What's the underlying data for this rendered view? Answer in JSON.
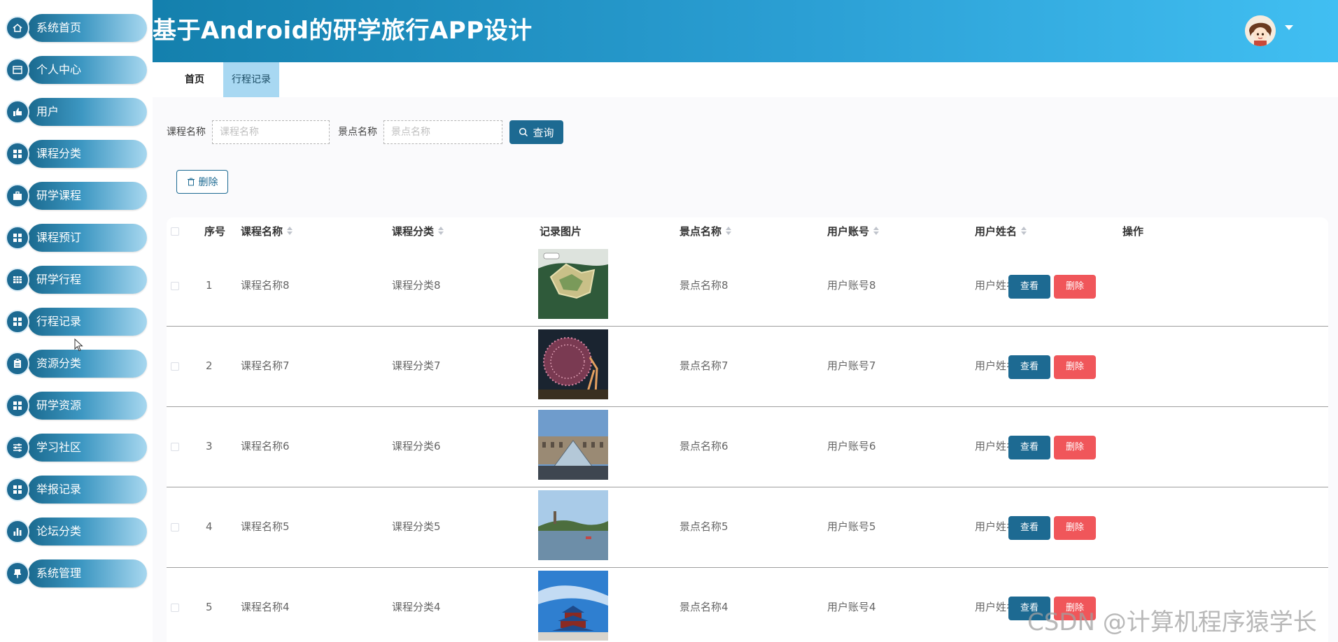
{
  "header": {
    "title": "基于Android的研学旅行APP设计"
  },
  "sidebar": {
    "items": [
      {
        "label": "系统首页",
        "icon": "home-icon"
      },
      {
        "label": "个人中心",
        "icon": "card-icon"
      },
      {
        "label": "用户",
        "icon": "thumb-icon"
      },
      {
        "label": "课程分类",
        "icon": "grid-icon"
      },
      {
        "label": "研学课程",
        "icon": "briefcase-icon"
      },
      {
        "label": "课程预订",
        "icon": "grid-icon"
      },
      {
        "label": "研学行程",
        "icon": "table-icon"
      },
      {
        "label": "行程记录",
        "icon": "grid-icon"
      },
      {
        "label": "资源分类",
        "icon": "clipboard-icon"
      },
      {
        "label": "研学资源",
        "icon": "grid-icon"
      },
      {
        "label": "学习社区",
        "icon": "sliders-icon"
      },
      {
        "label": "举报记录",
        "icon": "grid-icon"
      },
      {
        "label": "论坛分类",
        "icon": "bar-chart-icon"
      },
      {
        "label": "系统管理",
        "icon": "pushpin-icon"
      }
    ]
  },
  "tabs": [
    {
      "label": "首页",
      "active": false
    },
    {
      "label": "行程记录",
      "active": true
    }
  ],
  "search": {
    "course_label": "课程名称",
    "course_placeholder": "课程名称",
    "spot_label": "景点名称",
    "spot_placeholder": "景点名称",
    "query_label": "查询"
  },
  "toolbar": {
    "delete_label": "删除"
  },
  "table": {
    "columns": [
      "序号",
      "课程名称",
      "课程分类",
      "记录图片",
      "景点名称",
      "用户账号",
      "用户姓名",
      "操作"
    ],
    "rows": [
      {
        "index": "1",
        "course": "课程名称8",
        "category": "课程分类8",
        "spot": "景点名称8",
        "account": "用户账号8",
        "name": "用户姓名8"
      },
      {
        "index": "2",
        "course": "课程名称7",
        "category": "课程分类7",
        "spot": "景点名称7",
        "account": "用户账号7",
        "name": "用户姓名7"
      },
      {
        "index": "3",
        "course": "课程名称6",
        "category": "课程分类6",
        "spot": "景点名称6",
        "account": "用户账号6",
        "name": "用户姓名6"
      },
      {
        "index": "4",
        "course": "课程名称5",
        "category": "课程分类5",
        "spot": "景点名称5",
        "account": "用户账号5",
        "name": "用户姓名5"
      },
      {
        "index": "5",
        "course": "课程名称4",
        "category": "课程分类4",
        "spot": "景点名称4",
        "account": "用户账号4",
        "name": "用户姓名4"
      }
    ],
    "view_label": "查看",
    "delete_label": "删除"
  },
  "watermark": "CSDN @计算机程序猿学长",
  "colors": {
    "primary": "#1d6a92",
    "danger": "#f0565a",
    "header_start": "#1480ad",
    "header_end": "#41bff2",
    "tab_active": "#a8d8f2"
  }
}
